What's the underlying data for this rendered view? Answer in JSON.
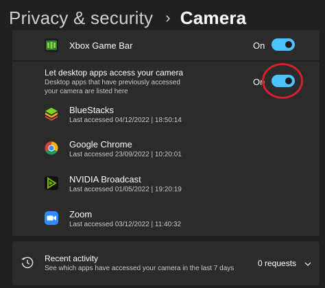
{
  "header": {
    "breadcrumb": "Privacy & security",
    "separator": "›",
    "title": "Camera"
  },
  "xbox": {
    "name": "Xbox Game Bar",
    "state_label": "On",
    "enabled": true
  },
  "desktop": {
    "title": "Let desktop apps access your camera",
    "description_line1": "Desktop apps that have previously accessed",
    "description_line2": "your camera are listed here",
    "state_label": "On",
    "enabled": true
  },
  "apps": [
    {
      "name": "BlueStacks",
      "last_accessed": "Last accessed 04/12/2022  |  18:50:14",
      "icon": "bluestacks-icon"
    },
    {
      "name": "Google Chrome",
      "last_accessed": "Last accessed 23/09/2022  |  10:20:01",
      "icon": "chrome-icon"
    },
    {
      "name": "NVIDIA Broadcast",
      "last_accessed": "Last accessed 01/05/2022  |  19:20:19",
      "icon": "nvidia-broadcast-icon"
    },
    {
      "name": "Zoom",
      "last_accessed": "Last accessed 03/12/2022  |  11:40:32",
      "icon": "zoom-icon"
    }
  ],
  "recent": {
    "title": "Recent activity",
    "description": "See which apps have accessed your camera in the last 7 days",
    "count": "0 requests",
    "icon": "history-icon"
  },
  "colors": {
    "background": "#202020",
    "card": "#2b2b2b",
    "accent": "#4cc2ff",
    "annotation": "#d81e2a"
  }
}
